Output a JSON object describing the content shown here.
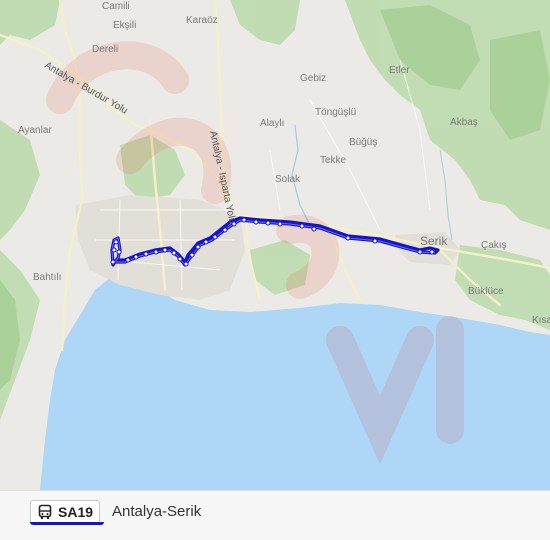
{
  "map": {
    "places": [
      {
        "name": "Camili",
        "kind": "village"
      },
      {
        "name": "Ekşili",
        "kind": "village"
      },
      {
        "name": "Karaöz",
        "kind": "village"
      },
      {
        "name": "Dereli",
        "kind": "village"
      },
      {
        "name": "Gebiz",
        "kind": "village"
      },
      {
        "name": "Etler",
        "kind": "village"
      },
      {
        "name": "Ayanlar",
        "kind": "village"
      },
      {
        "name": "Töngüşlü",
        "kind": "village"
      },
      {
        "name": "Alaylı",
        "kind": "village"
      },
      {
        "name": "Büğüş",
        "kind": "village"
      },
      {
        "name": "Akbaş",
        "kind": "village"
      },
      {
        "name": "Tekke",
        "kind": "village"
      },
      {
        "name": "Solak",
        "kind": "village"
      },
      {
        "name": "Serik",
        "kind": "city"
      },
      {
        "name": "Çakış",
        "kind": "village"
      },
      {
        "name": "Bahtılı",
        "kind": "village"
      },
      {
        "name": "Büklüce",
        "kind": "village"
      },
      {
        "name": "Kısa",
        "kind": "village"
      }
    ],
    "roads": [
      {
        "name": "Antalya - Burdur Yolu"
      },
      {
        "name": "Antalya - Isparta Yolu"
      }
    ],
    "colors": {
      "sea": "#aed6f7",
      "land": "#eceae6",
      "forest": "#bfdcb0",
      "route": "#1414c8"
    }
  },
  "footer": {
    "route_icon": "bus-icon",
    "route_code": "SA19",
    "route_name": "Antalya-Serik"
  }
}
